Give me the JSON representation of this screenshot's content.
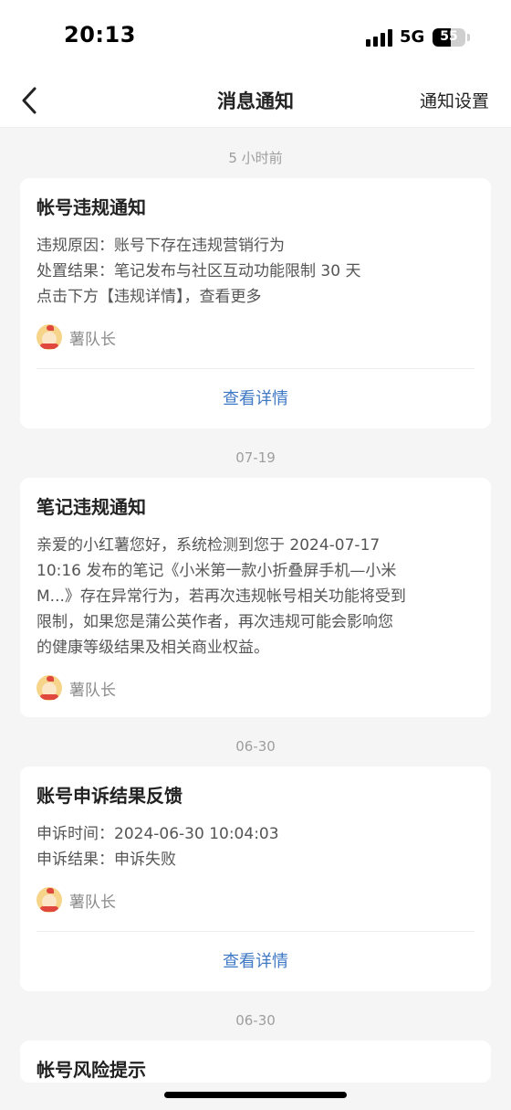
{
  "status_bar": {
    "time": "20:13",
    "network": "5G",
    "battery": "55",
    "battery_level": 0.55
  },
  "nav": {
    "title": "消息通知",
    "settings_label": "通知设置"
  },
  "messages": [
    {
      "time": "5 小时前",
      "title": "帐号违规通知",
      "lines": [
        "违规原因：账号下存在违规营销行为",
        "处置结果：笔记发布与社区互动功能限制 30 天",
        "点击下方【违规详情】，查看更多"
      ],
      "sender": "薯队长",
      "action": "查看详情"
    },
    {
      "time": "07-19",
      "title": "笔记违规通知",
      "lines": [
        "亲爱的小红薯您好，系统检测到您于 2024-07-17",
        "10:16 发布的笔记《小米第一款小折叠屏手机—小米",
        "M...》存在异常行为，若再次违规帐号相关功能将受到",
        "限制，如果您是蒲公英作者，再次违规可能会影响您",
        "的健康等级结果及相关商业权益。"
      ],
      "sender": "薯队长"
    },
    {
      "time": "06-30",
      "title": "账号申诉结果反馈",
      "lines": [
        "申诉时间：2024-06-30 10:04:03",
        "申诉结果：申诉失败"
      ],
      "sender": "薯队长",
      "action": "查看详情"
    },
    {
      "time": "06-30",
      "title": "帐号风险提示"
    }
  ]
}
